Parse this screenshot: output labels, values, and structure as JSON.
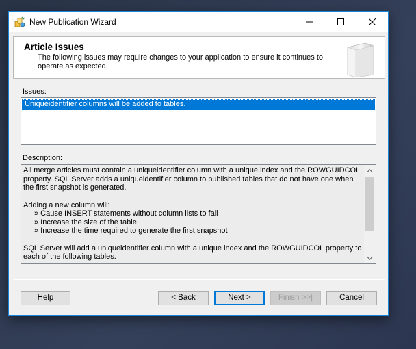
{
  "window": {
    "title": "New Publication Wizard",
    "icon": "wizard-icon"
  },
  "header": {
    "title": "Article Issues",
    "subtitle": "The following issues may require changes to your application to ensure it continues to operate as expected."
  },
  "issues": {
    "label": "Issues:",
    "items": [
      "Uniqueidentifier columns will be added to tables."
    ],
    "selected_index": 0
  },
  "description": {
    "label": "Description:",
    "para1": "All merge articles must contain a uniqueidentifier column with a unique index and the ROWGUIDCOL property. SQL Server adds a uniqueidentifier column to published tables that do not have one when the first snapshot is generated.",
    "para2": "Adding a new column will:",
    "bullets": [
      "» Cause INSERT statements without column lists to fail",
      "» Increase the size of the table",
      "» Increase the time required to generate the first snapshot"
    ],
    "para3": "SQL Server will add a uniqueidentifier column with a unique index and the ROWGUIDCOL property to each of the following tables."
  },
  "buttons": {
    "help": "Help",
    "back": "< Back",
    "next": "Next >",
    "finish": "Finish >>|",
    "cancel": "Cancel"
  },
  "colors": {
    "selection": "#0078d7",
    "window_border": "#1883d7",
    "dialog_bg": "#f0f0f0"
  }
}
